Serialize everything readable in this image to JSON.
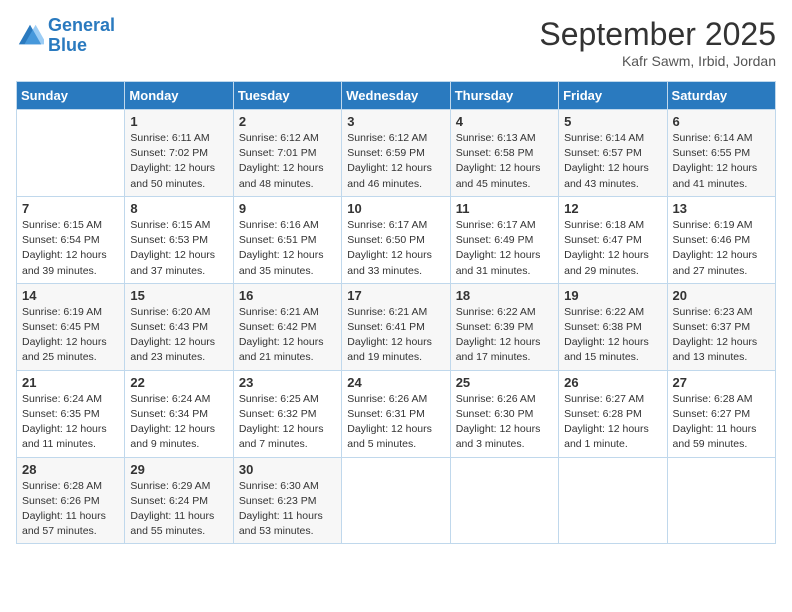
{
  "header": {
    "logo_line1": "General",
    "logo_line2": "Blue",
    "month_title": "September 2025",
    "location": "Kafr Sawm, Irbid, Jordan"
  },
  "weekdays": [
    "Sunday",
    "Monday",
    "Tuesday",
    "Wednesday",
    "Thursday",
    "Friday",
    "Saturday"
  ],
  "weeks": [
    [
      {
        "day": "",
        "text": ""
      },
      {
        "day": "1",
        "text": "Sunrise: 6:11 AM\nSunset: 7:02 PM\nDaylight: 12 hours\nand 50 minutes."
      },
      {
        "day": "2",
        "text": "Sunrise: 6:12 AM\nSunset: 7:01 PM\nDaylight: 12 hours\nand 48 minutes."
      },
      {
        "day": "3",
        "text": "Sunrise: 6:12 AM\nSunset: 6:59 PM\nDaylight: 12 hours\nand 46 minutes."
      },
      {
        "day": "4",
        "text": "Sunrise: 6:13 AM\nSunset: 6:58 PM\nDaylight: 12 hours\nand 45 minutes."
      },
      {
        "day": "5",
        "text": "Sunrise: 6:14 AM\nSunset: 6:57 PM\nDaylight: 12 hours\nand 43 minutes."
      },
      {
        "day": "6",
        "text": "Sunrise: 6:14 AM\nSunset: 6:55 PM\nDaylight: 12 hours\nand 41 minutes."
      }
    ],
    [
      {
        "day": "7",
        "text": "Sunrise: 6:15 AM\nSunset: 6:54 PM\nDaylight: 12 hours\nand 39 minutes."
      },
      {
        "day": "8",
        "text": "Sunrise: 6:15 AM\nSunset: 6:53 PM\nDaylight: 12 hours\nand 37 minutes."
      },
      {
        "day": "9",
        "text": "Sunrise: 6:16 AM\nSunset: 6:51 PM\nDaylight: 12 hours\nand 35 minutes."
      },
      {
        "day": "10",
        "text": "Sunrise: 6:17 AM\nSunset: 6:50 PM\nDaylight: 12 hours\nand 33 minutes."
      },
      {
        "day": "11",
        "text": "Sunrise: 6:17 AM\nSunset: 6:49 PM\nDaylight: 12 hours\nand 31 minutes."
      },
      {
        "day": "12",
        "text": "Sunrise: 6:18 AM\nSunset: 6:47 PM\nDaylight: 12 hours\nand 29 minutes."
      },
      {
        "day": "13",
        "text": "Sunrise: 6:19 AM\nSunset: 6:46 PM\nDaylight: 12 hours\nand 27 minutes."
      }
    ],
    [
      {
        "day": "14",
        "text": "Sunrise: 6:19 AM\nSunset: 6:45 PM\nDaylight: 12 hours\nand 25 minutes."
      },
      {
        "day": "15",
        "text": "Sunrise: 6:20 AM\nSunset: 6:43 PM\nDaylight: 12 hours\nand 23 minutes."
      },
      {
        "day": "16",
        "text": "Sunrise: 6:21 AM\nSunset: 6:42 PM\nDaylight: 12 hours\nand 21 minutes."
      },
      {
        "day": "17",
        "text": "Sunrise: 6:21 AM\nSunset: 6:41 PM\nDaylight: 12 hours\nand 19 minutes."
      },
      {
        "day": "18",
        "text": "Sunrise: 6:22 AM\nSunset: 6:39 PM\nDaylight: 12 hours\nand 17 minutes."
      },
      {
        "day": "19",
        "text": "Sunrise: 6:22 AM\nSunset: 6:38 PM\nDaylight: 12 hours\nand 15 minutes."
      },
      {
        "day": "20",
        "text": "Sunrise: 6:23 AM\nSunset: 6:37 PM\nDaylight: 12 hours\nand 13 minutes."
      }
    ],
    [
      {
        "day": "21",
        "text": "Sunrise: 6:24 AM\nSunset: 6:35 PM\nDaylight: 12 hours\nand 11 minutes."
      },
      {
        "day": "22",
        "text": "Sunrise: 6:24 AM\nSunset: 6:34 PM\nDaylight: 12 hours\nand 9 minutes."
      },
      {
        "day": "23",
        "text": "Sunrise: 6:25 AM\nSunset: 6:32 PM\nDaylight: 12 hours\nand 7 minutes."
      },
      {
        "day": "24",
        "text": "Sunrise: 6:26 AM\nSunset: 6:31 PM\nDaylight: 12 hours\nand 5 minutes."
      },
      {
        "day": "25",
        "text": "Sunrise: 6:26 AM\nSunset: 6:30 PM\nDaylight: 12 hours\nand 3 minutes."
      },
      {
        "day": "26",
        "text": "Sunrise: 6:27 AM\nSunset: 6:28 PM\nDaylight: 12 hours\nand 1 minute."
      },
      {
        "day": "27",
        "text": "Sunrise: 6:28 AM\nSunset: 6:27 PM\nDaylight: 11 hours\nand 59 minutes."
      }
    ],
    [
      {
        "day": "28",
        "text": "Sunrise: 6:28 AM\nSunset: 6:26 PM\nDaylight: 11 hours\nand 57 minutes."
      },
      {
        "day": "29",
        "text": "Sunrise: 6:29 AM\nSunset: 6:24 PM\nDaylight: 11 hours\nand 55 minutes."
      },
      {
        "day": "30",
        "text": "Sunrise: 6:30 AM\nSunset: 6:23 PM\nDaylight: 11 hours\nand 53 minutes."
      },
      {
        "day": "",
        "text": ""
      },
      {
        "day": "",
        "text": ""
      },
      {
        "day": "",
        "text": ""
      },
      {
        "day": "",
        "text": ""
      }
    ]
  ]
}
